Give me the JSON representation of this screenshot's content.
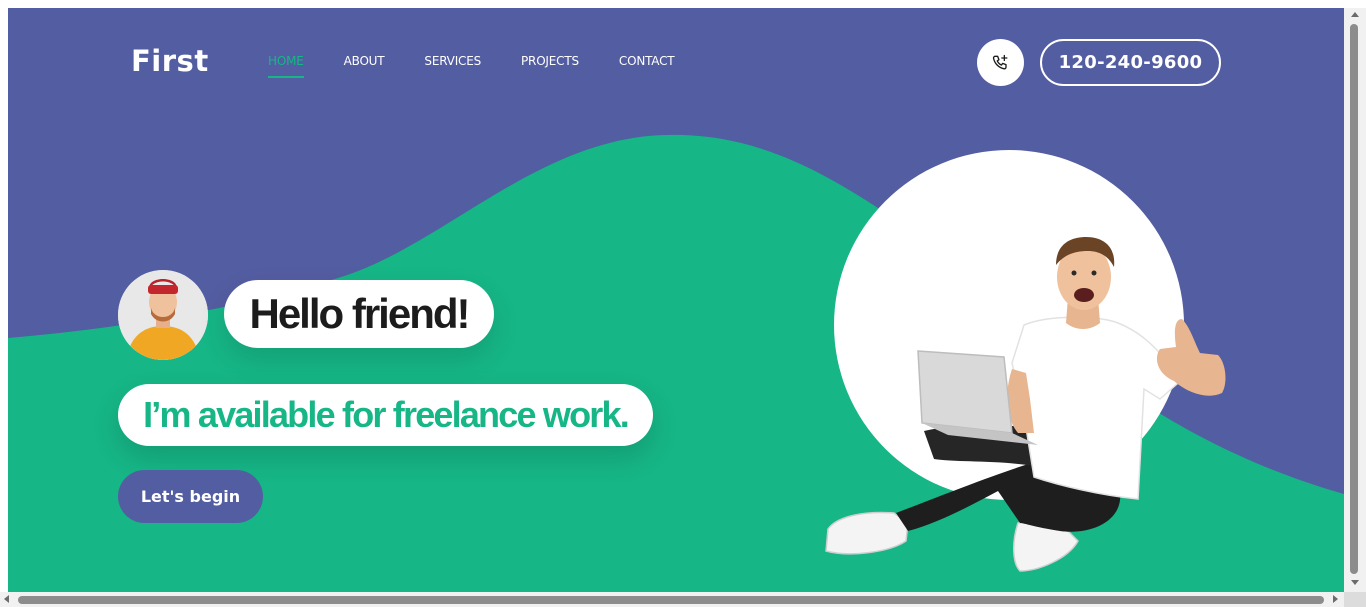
{
  "site": {
    "logo": "First"
  },
  "nav": {
    "items": [
      {
        "label": "HOME",
        "active": true
      },
      {
        "label": "ABOUT",
        "active": false
      },
      {
        "label": "SERVICES",
        "active": false
      },
      {
        "label": "PROJECTS",
        "active": false
      },
      {
        "label": "CONTACT",
        "active": false
      }
    ]
  },
  "header": {
    "phone_icon": "phone-add-icon",
    "phone_number": "120-240-9600"
  },
  "hero": {
    "greeting": "Hello friend!",
    "tagline": "I’m available for freelance work.",
    "cta_label": "Let's begin",
    "avatar": "avatar-photo",
    "photo": "man-with-laptop-photo"
  },
  "colors": {
    "primary": "#535da1",
    "accent": "#16b686",
    "text_dark": "#1c1c1c",
    "white": "#ffffff"
  }
}
